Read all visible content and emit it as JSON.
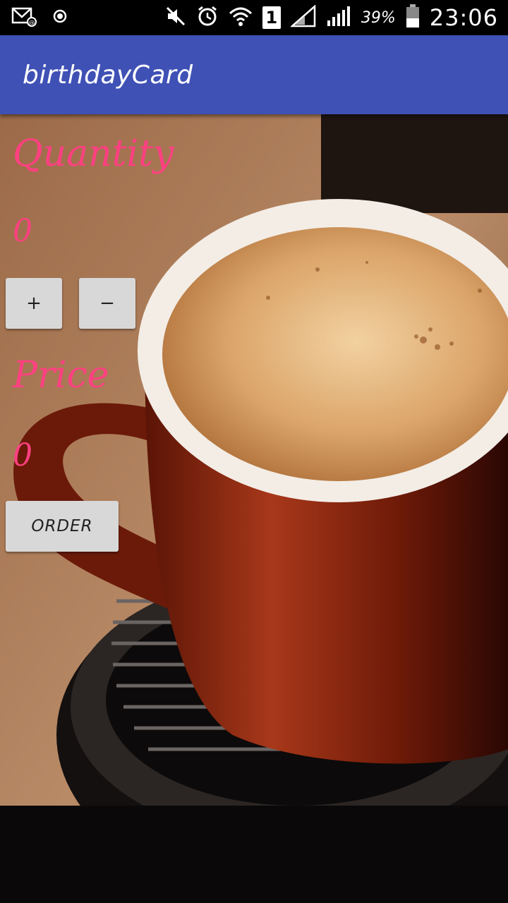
{
  "status_bar": {
    "battery_percent": "39%",
    "time": "23:06",
    "sim_slot": "1",
    "icons": [
      "mail-icon",
      "record-icon",
      "mute-icon",
      "alarm-icon",
      "wifi-icon",
      "sim-icon",
      "signal-icon",
      "signal-icon",
      "battery-icon"
    ]
  },
  "app_bar": {
    "title": "birthdayCard"
  },
  "quantity": {
    "label": "Quantity",
    "value": "0"
  },
  "buttons": {
    "plus": "+",
    "minus": "−",
    "order": "ORDER"
  },
  "price": {
    "label": "Price",
    "value": "0"
  },
  "colors": {
    "app_bar": "#3f51b5",
    "accent_text": "#ff4081",
    "button_bg": "#d8d8d8"
  }
}
